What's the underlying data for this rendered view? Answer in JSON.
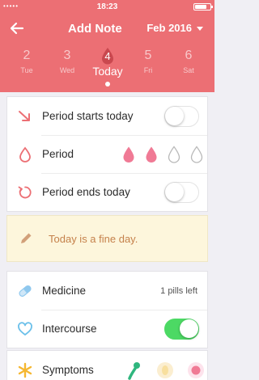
{
  "status_bar": {
    "time": "18:23",
    "signal": "•••••"
  },
  "nav": {
    "title": "Add Note",
    "month": "Feb 2016"
  },
  "days": [
    {
      "num": "2",
      "label": "Tue"
    },
    {
      "num": "3",
      "label": "Wed"
    },
    {
      "num": "4",
      "label": "Today"
    },
    {
      "num": "5",
      "label": "Fri"
    },
    {
      "num": "6",
      "label": "Sat"
    }
  ],
  "period_card": {
    "starts_label": "Period starts today",
    "starts_on": false,
    "period_label": "Period",
    "flow_level": 2,
    "flow_max": 4,
    "ends_label": "Period ends today",
    "ends_on": false
  },
  "note": {
    "text": "Today is a fine day."
  },
  "medicine": {
    "label": "Medicine",
    "pills_left": "1 pills left"
  },
  "intercourse": {
    "label": "Intercourse",
    "on": true
  },
  "symptoms": {
    "label": "Symptoms"
  },
  "colors": {
    "brand": "#ec6f74",
    "accent_pink": "#f07a95",
    "note_text": "#c5814b",
    "toggle_on": "#4cd964",
    "medicine_icon": "#8fc8ee",
    "heart_icon": "#6cc0ea",
    "symptom_icon": "#f5b731"
  }
}
